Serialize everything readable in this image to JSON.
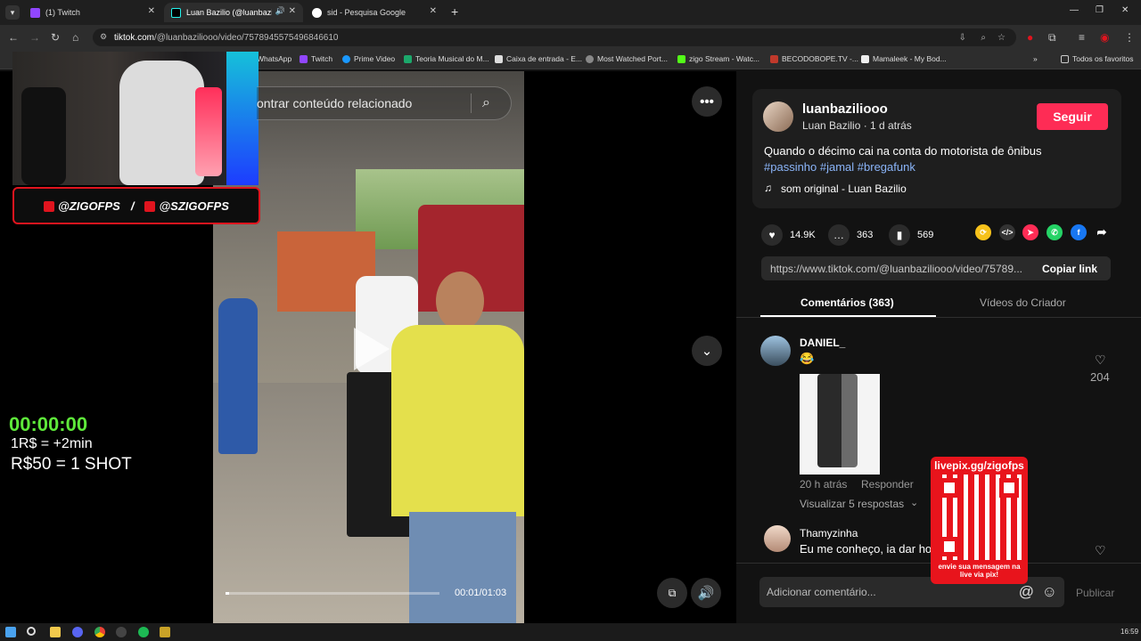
{
  "tabs": [
    {
      "title": "(1) Twitch",
      "active": false
    },
    {
      "title": "Luan Bazilio (@luanbazilio",
      "active": true
    },
    {
      "title": "sid - Pesquisa Google",
      "active": false
    }
  ],
  "address": {
    "host": "tiktok.com",
    "path": "/@luanbaziliooo/video/7578945575496846610"
  },
  "bookmarks": [
    "WhatsApp",
    "Twitch",
    "Prime Video",
    "Teoria Musical do M...",
    "Caixa de entrada - E...",
    "Most Watched Port...",
    "zigo Stream - Watc...",
    "BECODOBOPE.TV -...",
    "Mamaleek - My Bod...",
    "Todos os favoritos"
  ],
  "stream_overlay": {
    "handles": [
      "@ZIGOFPS",
      "/",
      "@SZIGOFPS"
    ],
    "timer": "00:00:00",
    "line1": "1R$ = +2min",
    "line2": "R$50 = 1 SHOT"
  },
  "search": {
    "placeholder": "ontrar conteúdo relacionado"
  },
  "player": {
    "time": "00:01/01:03",
    "progress": 0.016
  },
  "post": {
    "username": "luanbaziliooo",
    "meta": "Luan Bazilio · 1 d atrás",
    "follow": "Seguir",
    "caption": "Quando o décimo cai na conta do motorista de ônibus",
    "hashtags": "#passinho #jamal #bregafunk",
    "sound": "som original - Luan Bazilio"
  },
  "stats": {
    "likes": "14.9K",
    "comments": "363",
    "saves": "569"
  },
  "link": {
    "url": "https://www.tiktok.com/@luanbaziliooo/video/75789...",
    "copy": "Copiar link"
  },
  "panel_tabs": [
    "Comentários (363)",
    "Vídeos do Criador"
  ],
  "comments": [
    {
      "name": "DANIEL_",
      "text": "😂",
      "likes": "204",
      "time": "20 h atrás",
      "reply": "Responder",
      "view_replies": "Visualizar 5 respostas"
    },
    {
      "name": "Thamyzinha",
      "text": "Eu me conheço, ia dar ho"
    }
  ],
  "comment_input": {
    "placeholder": "Adicionar comentário...",
    "publish": "Publicar"
  },
  "qr": {
    "title": "livepix.gg/zigofps",
    "caption": "envie sua mensagem na live via pix!"
  },
  "clock": "16:59",
  "colors": {
    "accent": "#fe2c55",
    "hashtag": "#8ab4f8",
    "timer": "#5ee83a",
    "brand_red": "#e0141e"
  }
}
